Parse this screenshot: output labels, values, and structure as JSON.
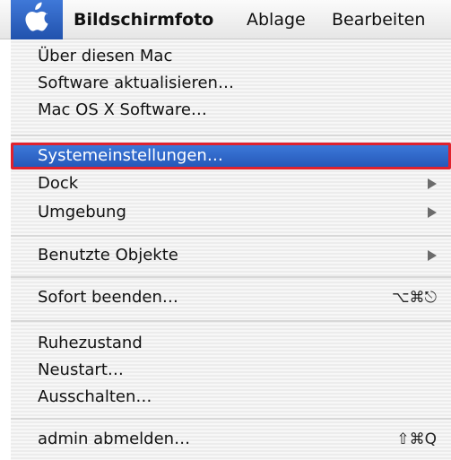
{
  "menubar": {
    "apple_icon": "apple-icon",
    "app_title": "Bildschirmfoto",
    "file_menu": "Ablage",
    "edit_menu": "Bearbeiten"
  },
  "menu": {
    "items": [
      {
        "label": "Über diesen Mac"
      },
      {
        "label": "Software aktualisieren…"
      },
      {
        "label": "Mac OS X Software…"
      },
      {
        "label": "Systemeinstellungen…",
        "selected": true
      },
      {
        "label": "Dock",
        "submenu": true
      },
      {
        "label": "Umgebung",
        "submenu": true
      },
      {
        "label": "Benutzte Objekte",
        "submenu": true
      },
      {
        "label": "Sofort beenden…",
        "shortcut": "⌥⌘⎋"
      },
      {
        "label": "Ruhezustand"
      },
      {
        "label": "Neustart…"
      },
      {
        "label": "Ausschalten…"
      },
      {
        "label": "admin abmelden…",
        "shortcut": "⇧⌘Q"
      }
    ]
  },
  "colors": {
    "selection": "#2c68c8",
    "highlight_border": "#e0222e",
    "apple_menu_bg": "#2961c2"
  }
}
